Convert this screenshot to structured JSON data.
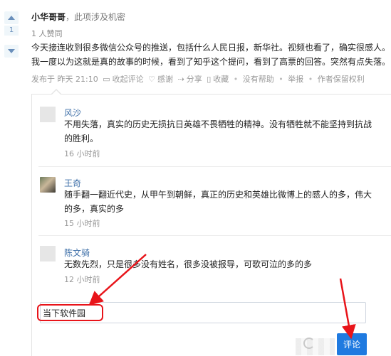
{
  "answer": {
    "vote_count": "1",
    "author_name": "小华哥哥",
    "author_bio": "，此项涉及机密",
    "likes": "1 人赞同",
    "content_lines": [
      "今天接连收到很多微信公众号的推送，包括什么人民日报，新华社。视频也看了，确实很感人。就在",
      "我一度以为这就是真的故事的时候，看到了知乎这个提问，看到了高票的回答。突然有点失落。"
    ],
    "meta": {
      "published": "发布于 昨天 21:10",
      "collapse_comments": "收起评论",
      "thanks": "感谢",
      "share": "分享",
      "favorite": "收藏",
      "not_helpful": "没有帮助",
      "report": "举报",
      "copyright": "作者保留权利"
    }
  },
  "comments": [
    {
      "name": "风沙",
      "lines": [
        "不用失落，真实的历史无损抗日英雄不畏牺牲的精神。没有牺牲就不能坚持到抗战",
        "的胜利。"
      ],
      "time": "16 小时前"
    },
    {
      "name": "王奇",
      "lines": [
        "随手翻一翻近代史，从甲午到朝鲜，真正的历史和英雄比微博上的感人的多，伟大",
        "的多，真实的多"
      ],
      "time": "15 小时前"
    },
    {
      "name": "陈文骑",
      "lines": [
        "无数先烈，只是很多没有姓名，很多没被报导，可歌可泣的多的多"
      ],
      "time": "12 小时前"
    }
  ],
  "comment_input": {
    "value": "当下软件园"
  },
  "submit_label": "评论",
  "colors": {
    "link": "#3e6fa8",
    "accent": "#1f7ae0",
    "annotation": "#e8141a"
  }
}
